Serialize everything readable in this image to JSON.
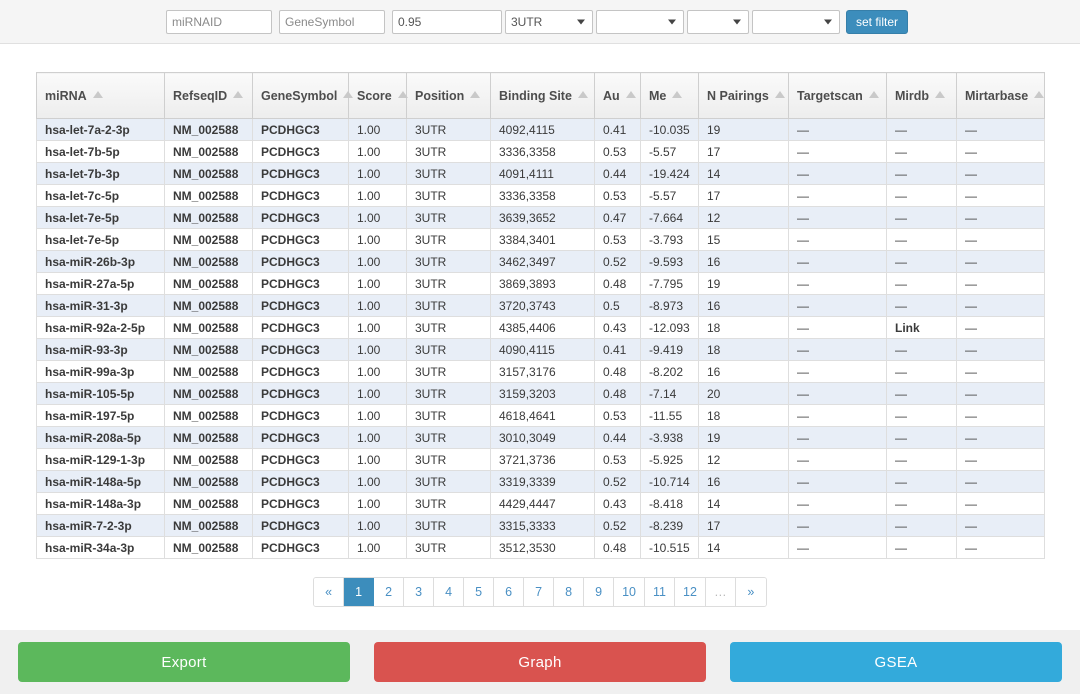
{
  "filters": {
    "mirnaid": {
      "value": "",
      "placeholder": "miRNAID"
    },
    "genesymbol": {
      "value": "",
      "placeholder": "GeneSymbol"
    },
    "score": {
      "value": "0.95",
      "placeholder": ""
    },
    "position_select": "3UTR",
    "select_b": "",
    "select_c": "",
    "select_d": "",
    "set_filter_label": "set filter"
  },
  "table": {
    "columns": [
      "miRNA",
      "RefseqID",
      "GeneSymbol",
      "Score",
      "Position",
      "Binding Site",
      "Au",
      "Me",
      "N Pairings",
      "Targetscan",
      "Mirdb",
      "Mirtarbase"
    ],
    "sort_icon": "sort-triangle-up-icon",
    "rows": [
      {
        "mirna": "hsa-let-7a-2-3p",
        "refseq": "NM_002588",
        "gene": "PCDHGC3",
        "score": "1.00",
        "position": "3UTR",
        "binding_site": "4092,4115",
        "au": "0.41",
        "me": "-10.035",
        "n_pairings": "19",
        "targetscan": "—",
        "mirdb": "—",
        "mirtarbase": "—"
      },
      {
        "mirna": "hsa-let-7b-5p",
        "refseq": "NM_002588",
        "gene": "PCDHGC3",
        "score": "1.00",
        "position": "3UTR",
        "binding_site": "3336,3358",
        "au": "0.53",
        "me": "-5.57",
        "n_pairings": "17",
        "targetscan": "—",
        "mirdb": "—",
        "mirtarbase": "—"
      },
      {
        "mirna": "hsa-let-7b-3p",
        "refseq": "NM_002588",
        "gene": "PCDHGC3",
        "score": "1.00",
        "position": "3UTR",
        "binding_site": "4091,4111",
        "au": "0.44",
        "me": "-19.424",
        "n_pairings": "14",
        "targetscan": "—",
        "mirdb": "—",
        "mirtarbase": "—"
      },
      {
        "mirna": "hsa-let-7c-5p",
        "refseq": "NM_002588",
        "gene": "PCDHGC3",
        "score": "1.00",
        "position": "3UTR",
        "binding_site": "3336,3358",
        "au": "0.53",
        "me": "-5.57",
        "n_pairings": "17",
        "targetscan": "—",
        "mirdb": "—",
        "mirtarbase": "—"
      },
      {
        "mirna": "hsa-let-7e-5p",
        "refseq": "NM_002588",
        "gene": "PCDHGC3",
        "score": "1.00",
        "position": "3UTR",
        "binding_site": "3639,3652",
        "au": "0.47",
        "me": "-7.664",
        "n_pairings": "12",
        "targetscan": "—",
        "mirdb": "—",
        "mirtarbase": "—"
      },
      {
        "mirna": "hsa-let-7e-5p",
        "refseq": "NM_002588",
        "gene": "PCDHGC3",
        "score": "1.00",
        "position": "3UTR",
        "binding_site": "3384,3401",
        "au": "0.53",
        "me": "-3.793",
        "n_pairings": "15",
        "targetscan": "—",
        "mirdb": "—",
        "mirtarbase": "—"
      },
      {
        "mirna": "hsa-miR-26b-3p",
        "refseq": "NM_002588",
        "gene": "PCDHGC3",
        "score": "1.00",
        "position": "3UTR",
        "binding_site": "3462,3497",
        "au": "0.52",
        "me": "-9.593",
        "n_pairings": "16",
        "targetscan": "—",
        "mirdb": "—",
        "mirtarbase": "—"
      },
      {
        "mirna": "hsa-miR-27a-5p",
        "refseq": "NM_002588",
        "gene": "PCDHGC3",
        "score": "1.00",
        "position": "3UTR",
        "binding_site": "3869,3893",
        "au": "0.48",
        "me": "-7.795",
        "n_pairings": "19",
        "targetscan": "—",
        "mirdb": "—",
        "mirtarbase": "—"
      },
      {
        "mirna": "hsa-miR-31-3p",
        "refseq": "NM_002588",
        "gene": "PCDHGC3",
        "score": "1.00",
        "position": "3UTR",
        "binding_site": "3720,3743",
        "au": "0.5",
        "me": "-8.973",
        "n_pairings": "16",
        "targetscan": "—",
        "mirdb": "—",
        "mirtarbase": "—"
      },
      {
        "mirna": "hsa-miR-92a-2-5p",
        "refseq": "NM_002588",
        "gene": "PCDHGC3",
        "score": "1.00",
        "position": "3UTR",
        "binding_site": "4385,4406",
        "au": "0.43",
        "me": "-12.093",
        "n_pairings": "18",
        "targetscan": "—",
        "mirdb": "Link",
        "mirtarbase": "—"
      },
      {
        "mirna": "hsa-miR-93-3p",
        "refseq": "NM_002588",
        "gene": "PCDHGC3",
        "score": "1.00",
        "position": "3UTR",
        "binding_site": "4090,4115",
        "au": "0.41",
        "me": "-9.419",
        "n_pairings": "18",
        "targetscan": "—",
        "mirdb": "—",
        "mirtarbase": "—"
      },
      {
        "mirna": "hsa-miR-99a-3p",
        "refseq": "NM_002588",
        "gene": "PCDHGC3",
        "score": "1.00",
        "position": "3UTR",
        "binding_site": "3157,3176",
        "au": "0.48",
        "me": "-8.202",
        "n_pairings": "16",
        "targetscan": "—",
        "mirdb": "—",
        "mirtarbase": "—"
      },
      {
        "mirna": "hsa-miR-105-5p",
        "refseq": "NM_002588",
        "gene": "PCDHGC3",
        "score": "1.00",
        "position": "3UTR",
        "binding_site": "3159,3203",
        "au": "0.48",
        "me": "-7.14",
        "n_pairings": "20",
        "targetscan": "—",
        "mirdb": "—",
        "mirtarbase": "—"
      },
      {
        "mirna": "hsa-miR-197-5p",
        "refseq": "NM_002588",
        "gene": "PCDHGC3",
        "score": "1.00",
        "position": "3UTR",
        "binding_site": "4618,4641",
        "au": "0.53",
        "me": "-11.55",
        "n_pairings": "18",
        "targetscan": "—",
        "mirdb": "—",
        "mirtarbase": "—"
      },
      {
        "mirna": "hsa-miR-208a-5p",
        "refseq": "NM_002588",
        "gene": "PCDHGC3",
        "score": "1.00",
        "position": "3UTR",
        "binding_site": "3010,3049",
        "au": "0.44",
        "me": "-3.938",
        "n_pairings": "19",
        "targetscan": "—",
        "mirdb": "—",
        "mirtarbase": "—"
      },
      {
        "mirna": "hsa-miR-129-1-3p",
        "refseq": "NM_002588",
        "gene": "PCDHGC3",
        "score": "1.00",
        "position": "3UTR",
        "binding_site": "3721,3736",
        "au": "0.53",
        "me": "-5.925",
        "n_pairings": "12",
        "targetscan": "—",
        "mirdb": "—",
        "mirtarbase": "—"
      },
      {
        "mirna": "hsa-miR-148a-5p",
        "refseq": "NM_002588",
        "gene": "PCDHGC3",
        "score": "1.00",
        "position": "3UTR",
        "binding_site": "3319,3339",
        "au": "0.52",
        "me": "-10.714",
        "n_pairings": "16",
        "targetscan": "—",
        "mirdb": "—",
        "mirtarbase": "—"
      },
      {
        "mirna": "hsa-miR-148a-3p",
        "refseq": "NM_002588",
        "gene": "PCDHGC3",
        "score": "1.00",
        "position": "3UTR",
        "binding_site": "4429,4447",
        "au": "0.43",
        "me": "-8.418",
        "n_pairings": "14",
        "targetscan": "—",
        "mirdb": "—",
        "mirtarbase": "—"
      },
      {
        "mirna": "hsa-miR-7-2-3p",
        "refseq": "NM_002588",
        "gene": "PCDHGC3",
        "score": "1.00",
        "position": "3UTR",
        "binding_site": "3315,3333",
        "au": "0.52",
        "me": "-8.239",
        "n_pairings": "17",
        "targetscan": "—",
        "mirdb": "—",
        "mirtarbase": "—"
      },
      {
        "mirna": "hsa-miR-34a-3p",
        "refseq": "NM_002588",
        "gene": "PCDHGC3",
        "score": "1.00",
        "position": "3UTR",
        "binding_site": "3512,3530",
        "au": "0.48",
        "me": "-10.515",
        "n_pairings": "14",
        "targetscan": "—",
        "mirdb": "—",
        "mirtarbase": "—"
      }
    ]
  },
  "pagination": {
    "prev": "«",
    "next": "»",
    "ellipsis": "…",
    "pages": [
      "1",
      "2",
      "3",
      "4",
      "5",
      "6",
      "7",
      "8",
      "9",
      "10",
      "11",
      "12"
    ],
    "active": "1"
  },
  "actions": {
    "export": "Export",
    "graph": "Graph",
    "gsea": "GSEA"
  },
  "colors": {
    "primary": "#3c8dbc",
    "export_green": "#5cb85c",
    "graph_red": "#d9534f",
    "gsea_blue": "#33aadb",
    "row_stripe": "#e8eef7",
    "link_blue": "#3b6ea5"
  }
}
